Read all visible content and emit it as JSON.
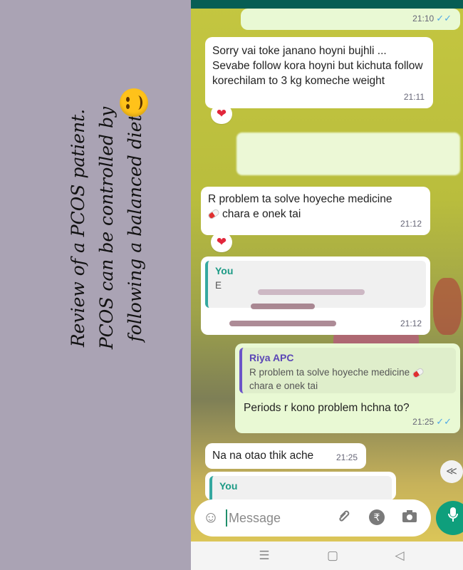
{
  "caption": {
    "lines": [
      "Review of a PCOS patient.",
      "PCOS can be controlled by",
      "following a balanced diet"
    ],
    "emoji": "smiley-emoji"
  },
  "chat": {
    "messages": [
      {
        "time": "21:10",
        "ticks": "✓✓"
      },
      {
        "text": "Sorry vai toke janano hoyni bujhli ... Sevabe follow kora hoyni but kichuta follow korechilam to 3 kg komeche weight",
        "time": "21:11",
        "reaction": "❤"
      },
      {
        "text_before": "R problem ta solve hoyeche medicine",
        "text_after": "chara e onek tai",
        "time": "21:12",
        "reaction": "❤"
      },
      {
        "quote_name": "You",
        "quote_text": "E",
        "time": "21:12"
      },
      {
        "quote_name": "Riya APC",
        "quote_text_before": "R problem ta solve hoyeche medicine",
        "quote_text_after": "chara e onek tai",
        "text": "Periods r kono problem hchna to?",
        "time": "21:25",
        "ticks": "✓✓"
      },
      {
        "text": "Na na otao thik ache",
        "time": "21:25"
      },
      {
        "quote_name": "You"
      }
    ],
    "scroll_down": "≪"
  },
  "input": {
    "placeholder": "Message",
    "icons": [
      "emoji-icon",
      "attach-icon",
      "rupee-icon",
      "camera-icon",
      "mic-icon"
    ],
    "rupee": "₹"
  },
  "navbar": {
    "menu": "☰",
    "home": "▢",
    "back": "◁"
  }
}
